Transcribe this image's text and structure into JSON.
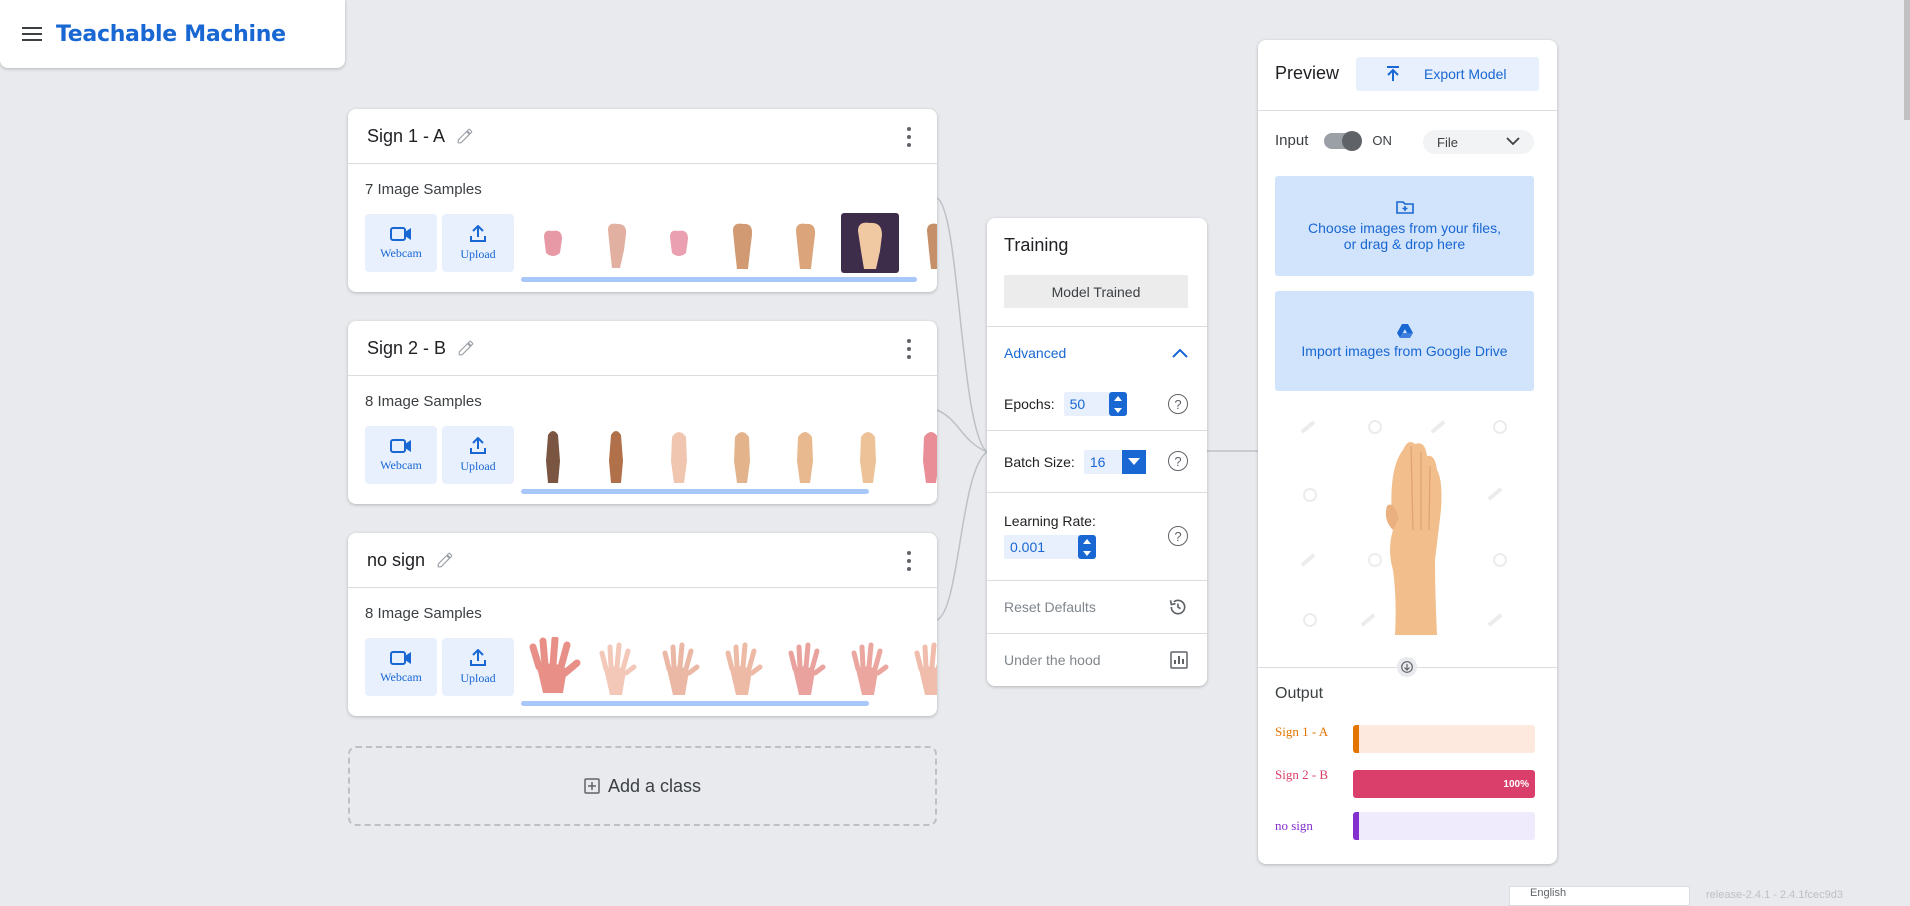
{
  "app": {
    "title": "Teachable Machine"
  },
  "classes": [
    {
      "name": "Sign 1 - A",
      "samples": "7 Image Samples",
      "webcam": "Webcam",
      "upload": "Upload"
    },
    {
      "name": "Sign 2 - B",
      "samples": "8 Image Samples",
      "webcam": "Webcam",
      "upload": "Upload"
    },
    {
      "name": "no sign",
      "samples": "8 Image Samples",
      "webcam": "Webcam",
      "upload": "Upload"
    }
  ],
  "add_class": "Add a class",
  "training": {
    "title": "Training",
    "status": "Model Trained",
    "advanced": "Advanced",
    "epochs_label": "Epochs:",
    "epochs_value": "50",
    "batch_label": "Batch Size:",
    "batch_value": "16",
    "lr_label": "Learning Rate:",
    "lr_value": "0.001",
    "reset": "Reset Defaults",
    "under_hood": "Under the hood"
  },
  "preview": {
    "title": "Preview",
    "export": "Export Model",
    "input_label": "Input",
    "toggle_state": "ON",
    "source_select": "File",
    "drop_line1": "Choose images from your files,",
    "drop_line2": "or drag & drop here",
    "drive": "Import images from Google Drive",
    "output_title": "Output",
    "outputs": [
      {
        "label": "Sign 1 - A",
        "percent": "",
        "value": 0,
        "color": "#e37400",
        "track": "#fde9de"
      },
      {
        "label": "Sign 2 - B",
        "percent": "100%",
        "value": 1.0,
        "color": "#d93f6a",
        "track": "#fbe1e8"
      },
      {
        "label": "no sign",
        "percent": "",
        "value": 0,
        "color": "#8430ce",
        "track": "#f0eafd"
      }
    ]
  },
  "footer": {
    "language": "English",
    "version": "release-2.4.1 - 2.4.1fcec9d3"
  }
}
